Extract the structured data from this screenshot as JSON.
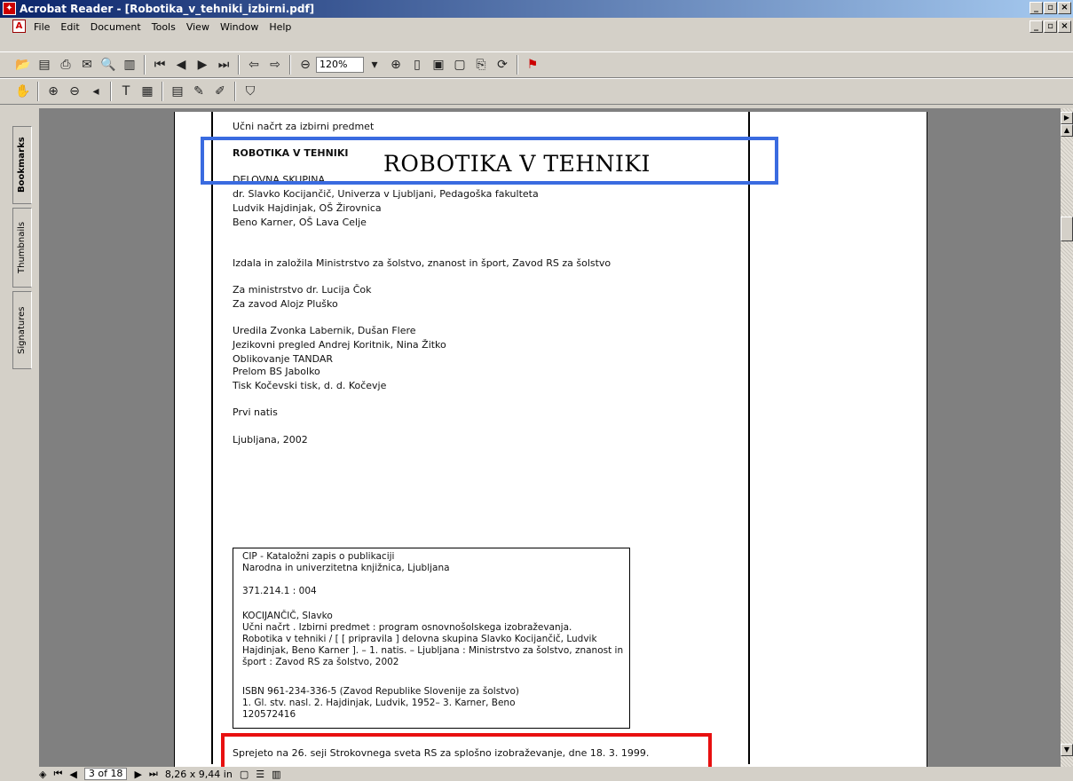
{
  "window": {
    "title": "Acrobat Reader - [Robotika_v_tehniki_izbirni.pdf]"
  },
  "menu": [
    "File",
    "Edit",
    "Document",
    "Tools",
    "View",
    "Window",
    "Help"
  ],
  "toolbar": {
    "zoom": "120%"
  },
  "tabs": [
    "Bookmarks",
    "Thumbnails",
    "Signatures"
  ],
  "doc": {
    "header": "Učni načrt za izbirni predmet",
    "subject": "ROBOTIKA V TEHNIKI",
    "group_label": "DELOVNA SKUPINA",
    "members": [
      "dr. Slavko Kocijančič, Univerza v Ljubljani, Pedagoška fakulteta",
      "Ludvik Hajdinjak, OŠ Žirovnica",
      "Beno Karner, OŠ Lava Celje"
    ],
    "publisher": "Izdala in založila Ministrstvo za šolstvo, znanost in šport, Zavod RS za šolstvo",
    "ministry": "Za ministrstvo dr. Lucija Čok",
    "institute": "Za zavod Alojz Pluško",
    "credits": [
      "Uredila Zvonka Labernik, Dušan Flere",
      "Jezikovni pregled Andrej Koritnik, Nina Žitko",
      "Oblikovanje TANDAR",
      "Prelom BS Jabolko",
      "Tisk Kočevski tisk, d. d. Kočevje"
    ],
    "edition": "Prvi natis",
    "place_date": "Ljubljana, 2002",
    "cip": [
      "CIP - Kataložni zapis o publikaciji",
      "Narodna in univerzitetna knjižnica, Ljubljana",
      "371.214.1 : 004",
      "KOCIJANČIČ, Slavko",
      "   Učni načrt . Izbirni predmet : program osnovnošolskega izobraževanja.",
      "Robotika v tehniki / [ [ pripravila ] delovna skupina Slavko Kocijančič, Ludvik",
      "Hajdinjak, Beno Karner ]. – 1. natis. – Ljubljana : Ministrstvo za šolstvo, znanost in",
      "šport : Zavod RS za šolstvo, 2002",
      "ISBN 961-234-336-5 (Zavod Republike Slovenije za šolstvo)",
      "1. Gl. stv. nasl. 2. Hajdinjak, Ludvik, 1952– 3. Karner, Beno",
      "120572416"
    ],
    "footer": "Sprejeto na 26. seji Strokovnega sveta RS za splošno izobraževanje, dne 18. 3. 1999."
  },
  "overlay": {
    "big_title": "ROBOTIKA V TEHNIKI"
  },
  "status": {
    "page": "3 of 18",
    "size": "8,26 x 9,44 in"
  }
}
